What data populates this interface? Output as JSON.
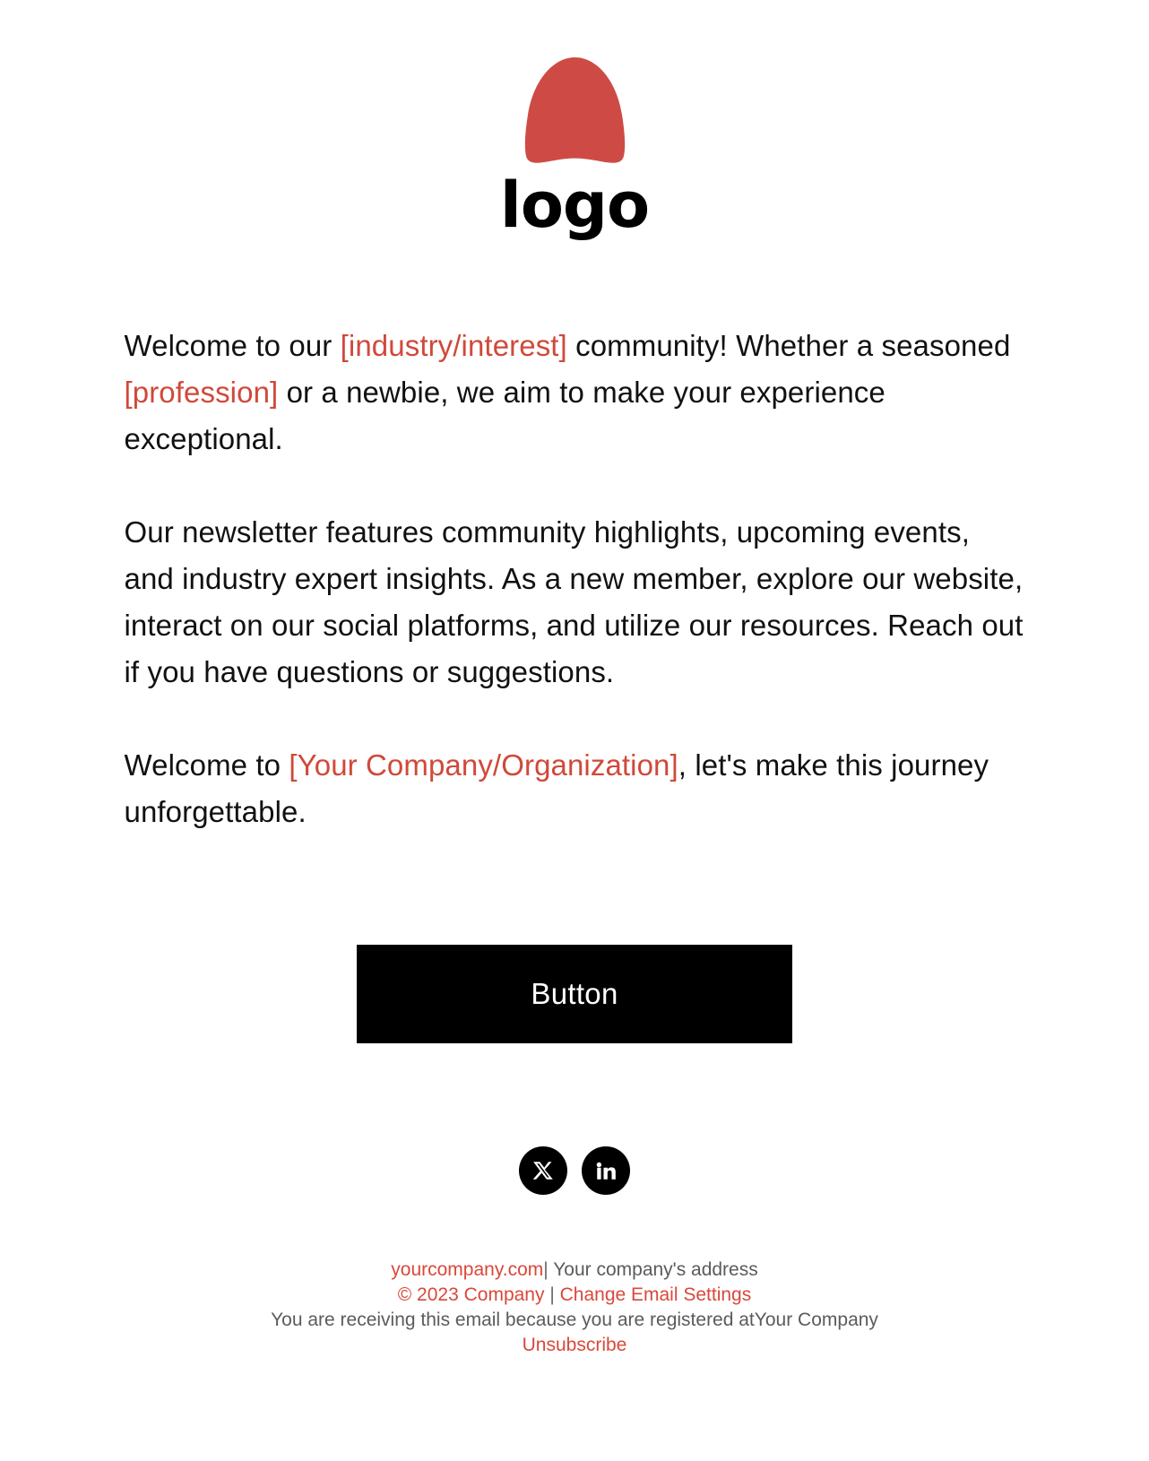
{
  "logo": {
    "mark_name": "dome-logo-mark",
    "mark_color": "#ce4b45",
    "wordmark": "logo"
  },
  "theme": {
    "accent_red": "#d0493a",
    "footer_red": "#d9483b",
    "text_black": "#111111",
    "button_bg": "#000000",
    "background": "#ffffff"
  },
  "body": {
    "paragraph1": {
      "seg1": "Welcome to our ",
      "placeholder1": "[industry/interest]",
      "seg2": " community! Whether a seasoned ",
      "placeholder2": "[profession]",
      "seg3": " or a newbie, we aim to make your experience exceptional."
    },
    "paragraph2": "Our newsletter features community highlights, upcoming events, and industry expert insights. As a new member, explore our website, interact on our social platforms, and utilize our resources. Reach out if you have questions or suggestions.",
    "paragraph3": {
      "seg1": "Welcome to ",
      "placeholder1": "[Your Company/Organization]",
      "seg2": ", let's make this journey unforgettable."
    }
  },
  "cta": {
    "label": "Button"
  },
  "social": {
    "items": [
      {
        "icon": "x-twitter-icon",
        "name": "X"
      },
      {
        "icon": "linkedin-icon",
        "name": "LinkedIn"
      }
    ]
  },
  "footer": {
    "line1": {
      "website": "yourcompany.com",
      "separator": "|",
      "address": " Your company's address"
    },
    "line2": {
      "copyright": "© 2023 Company",
      "separator": " | ",
      "settings_link": "Change Email Settings"
    },
    "line3": {
      "notice": "You are receiving this email because you are registered at",
      "company": "Your Company"
    },
    "line4": {
      "unsubscribe": "Unsubscribe"
    }
  }
}
